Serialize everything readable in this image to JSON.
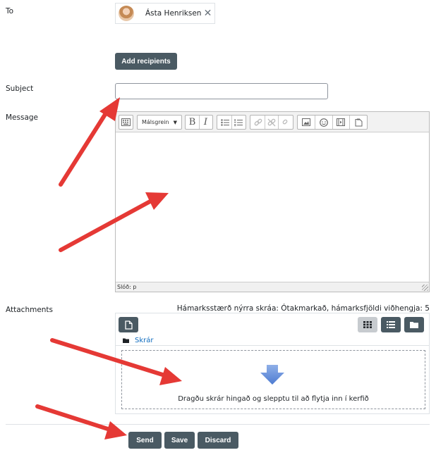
{
  "form": {
    "to_label": "To",
    "subject_label": "Subject",
    "message_label": "Message",
    "attachments_label": "Attachments",
    "subject_value": ""
  },
  "recipients": [
    {
      "name": "Ásta Henriksen"
    }
  ],
  "buttons": {
    "add_recipients": "Add recipients",
    "send": "Send",
    "save": "Save",
    "discard": "Discard"
  },
  "editor": {
    "font_select": "Málsgrein",
    "bold": "B",
    "italic": "I",
    "status_path": "Slóð: p",
    "toolbar_icons": [
      "toolbar-toggle-icon",
      "bold-icon",
      "italic-icon",
      "unordered-list-icon",
      "ordered-list-icon",
      "link-icon",
      "unlink-icon",
      "nolink-icon",
      "image-icon",
      "emoticon-icon",
      "media-icon",
      "manage-files-icon"
    ]
  },
  "attachments": {
    "max_info": "Hámarksstærð nýrra skráa: Ótakmarkað, hámarksfjöldi viðhengja: 5",
    "folder_path": "Skrár",
    "drop_text": "Dragðu skrár hingað og slepptu til að flytja inn í kerfið"
  },
  "colors": {
    "button_bg": "#4a5a63",
    "arrow": "#e53935",
    "link": "#0f6cbf"
  }
}
